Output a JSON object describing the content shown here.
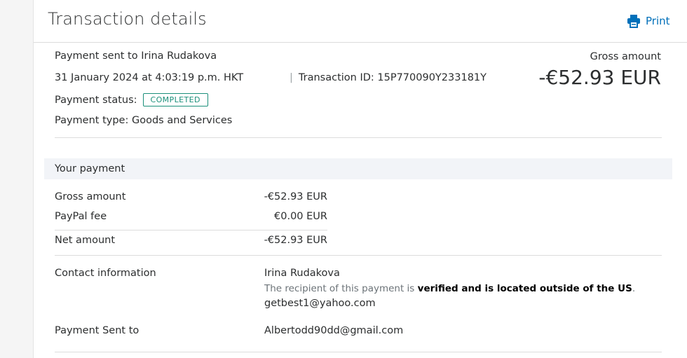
{
  "header": {
    "title": "Transaction details",
    "print_label": "Print"
  },
  "summary": {
    "recipient_line": "Payment sent to Irina Rudakova",
    "datetime": "31 January 2024 at 4:03:19 p.m. HKT",
    "separator": "|",
    "transaction_id": "Transaction ID: 15P770090Y233181Y",
    "status_label": "Payment status:",
    "status_value": "COMPLETED",
    "payment_type": "Payment type: Goods and Services",
    "gross_label": "Gross amount",
    "gross_value": "-€52.93 EUR"
  },
  "your_payment": {
    "heading": "Your payment",
    "rows": [
      {
        "label": "Gross amount",
        "value": "-€52.93 EUR"
      },
      {
        "label": "PayPal fee",
        "value": "€0.00 EUR"
      },
      {
        "label": "Net amount",
        "value": "-€52.93 EUR"
      }
    ]
  },
  "contact": {
    "label": "Contact information",
    "name": "Irina Rudakova",
    "note_prefix": "The recipient of this payment is ",
    "note_bold": "verified and is located outside of the US",
    "note_suffix": ".",
    "email": "getbest1@yahoo.com"
  },
  "sent_to": {
    "label": "Payment Sent to",
    "email": "Albertodd90dd@gmail.com"
  },
  "colors": {
    "accent": "#0070ba",
    "status": "#1b8f7a",
    "section_bg": "#f2f4f8"
  }
}
